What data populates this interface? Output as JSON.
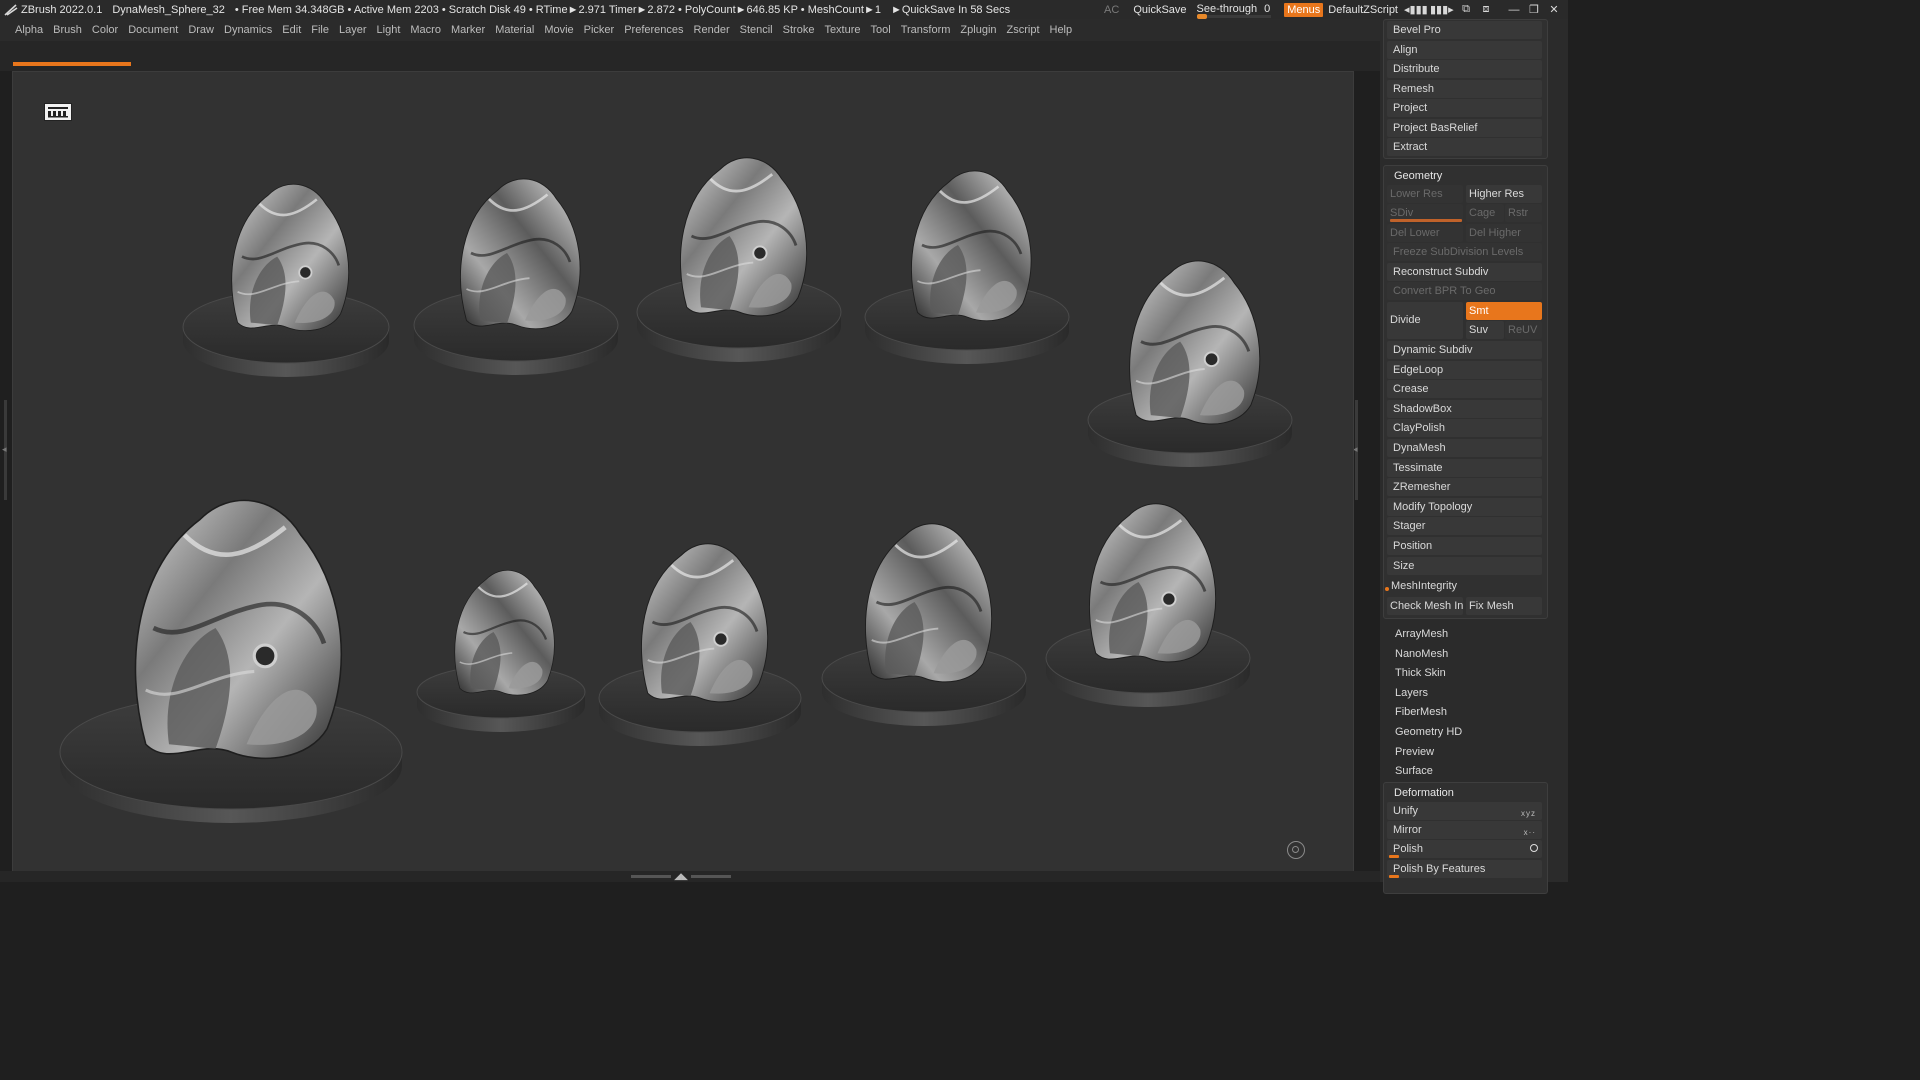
{
  "titlebar": {
    "app": "ZBrush 2022.0.1",
    "tool": "DynaMesh_Sphere_32",
    "stats": "• Free Mem 34.348GB • Active Mem 2203 • Scratch Disk 49 •  RTime►2.971 Timer►2.872 • PolyCount►646.85 KP  • MeshCount►1",
    "quicksave_info": "►QuickSave In 58 Secs",
    "ac": "AC",
    "quicksave": "QuickSave",
    "see_through_label": "See-through",
    "see_through_value": "0",
    "menus": "Menus",
    "script": "DefaultZScript"
  },
  "menubar": [
    "Alpha",
    "Brush",
    "Color",
    "Document",
    "Draw",
    "Dynamics",
    "Edit",
    "File",
    "Layer",
    "Light",
    "Macro",
    "Marker",
    "Material",
    "Movie",
    "Picker",
    "Preferences",
    "Render",
    "Stencil",
    "Stroke",
    "Texture",
    "Tool",
    "Transform",
    "Zplugin",
    "Zscript",
    "Help"
  ],
  "palette": {
    "top_group": [
      "Bevel Pro",
      "Align",
      "Distribute",
      "Remesh",
      "Project",
      "Project BasRelief",
      "Extract"
    ],
    "geometry": {
      "title": "Geometry",
      "lower_res": "Lower Res",
      "higher_res": "Higher Res",
      "sdiv": "SDiv",
      "cage": "Cage",
      "rstr": "Rstr",
      "del_lower": "Del Lower",
      "del_higher": "Del Higher",
      "freeze": "Freeze SubDivision Levels",
      "reconstruct": "Reconstruct Subdiv",
      "convert_bpr": "Convert BPR To Geo",
      "divide": "Divide",
      "smt": "Smt",
      "suv": "Suv",
      "reuv": "ReUV",
      "items": [
        "Dynamic Subdiv",
        "EdgeLoop",
        "Crease",
        "ShadowBox",
        "ClayPolish",
        "DynaMesh",
        "Tessimate",
        "ZRemesher",
        "Modify Topology",
        "Stager",
        "Position",
        "Size"
      ],
      "meshintegrity": "MeshIntegrity",
      "check_mesh": "Check Mesh Integrity",
      "fix_mesh": "Fix Mesh"
    },
    "subpalettes": [
      "ArrayMesh",
      "NanoMesh",
      "Thick Skin",
      "Layers",
      "FiberMesh",
      "Geometry HD",
      "Preview",
      "Surface"
    ],
    "deformation": {
      "title": "Deformation",
      "unify": "Unify",
      "mirror": "Mirror",
      "polish": "Polish",
      "polish_features": "Polish By Features"
    }
  },
  "colors": {
    "accent": "#e8761c",
    "canvas": "#323232",
    "panel": "#2b2b2b"
  }
}
